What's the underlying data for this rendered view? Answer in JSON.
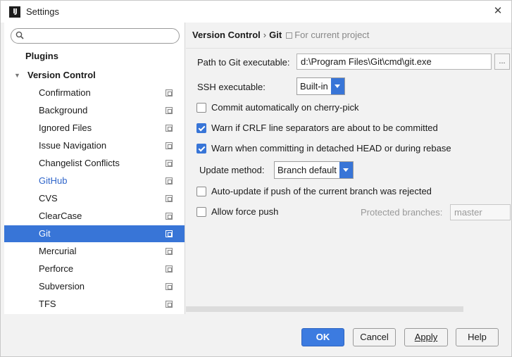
{
  "window": {
    "title": "Settings",
    "app_icon_text": "IJ"
  },
  "sidebar": {
    "search_value": "",
    "items": [
      {
        "label": "Plugins"
      },
      {
        "label": "Version Control"
      },
      {
        "label": "Confirmation"
      },
      {
        "label": "Background"
      },
      {
        "label": "Ignored Files"
      },
      {
        "label": "Issue Navigation"
      },
      {
        "label": "Changelist Conflicts"
      },
      {
        "label": "GitHub"
      },
      {
        "label": "CVS"
      },
      {
        "label": "ClearCase"
      },
      {
        "label": "Git"
      },
      {
        "label": "Mercurial"
      },
      {
        "label": "Perforce"
      },
      {
        "label": "Subversion"
      },
      {
        "label": "TFS"
      }
    ],
    "selected": "Git"
  },
  "breadcrumb": {
    "parent": "Version Control",
    "separator": "›",
    "current": "Git",
    "scope": "For current project"
  },
  "git": {
    "path_label": "Path to Git executable:",
    "path_value": "d:\\Program Files\\Git\\cmd\\git.exe",
    "browse_label": "...",
    "ssh_label": "SSH executable:",
    "ssh_value": "Built-in",
    "commit_cherry_pick": {
      "label": "Commit automatically on cherry-pick",
      "checked": false
    },
    "warn_crlf": {
      "label": "Warn if CRLF line separators are about to be committed",
      "checked": true
    },
    "warn_detached": {
      "label": "Warn when committing in detached HEAD or during rebase",
      "checked": true
    },
    "update_method_label": "Update method:",
    "update_method_value": "Branch default",
    "auto_update": {
      "label": "Auto-update if push of the current branch was rejected",
      "checked": false
    },
    "allow_force_push": {
      "label": "Allow force push",
      "checked": false
    },
    "protected_branches_label": "Protected branches:",
    "protected_branches_value": "master"
  },
  "buttons": {
    "ok": "OK",
    "cancel": "Cancel",
    "apply": "Apply",
    "help": "Help"
  },
  "colors": {
    "accent": "#3875d7",
    "link": "#2f65ca"
  }
}
